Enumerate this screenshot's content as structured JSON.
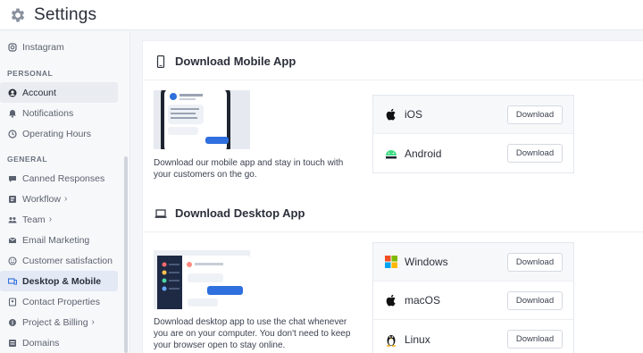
{
  "header": {
    "title": "Settings",
    "icon": "gear-icon"
  },
  "sidebar": {
    "top_item": {
      "label": "Instagram",
      "icon": "instagram-icon"
    },
    "sections": [
      {
        "title": "PERSONAL"
      },
      {
        "title": "GENERAL"
      }
    ],
    "personal_items": [
      {
        "label": "Account",
        "icon": "user-icon",
        "state": "active"
      },
      {
        "label": "Notifications",
        "icon": "bell-icon"
      },
      {
        "label": "Operating Hours",
        "icon": "clock-icon"
      }
    ],
    "general_items": [
      {
        "label": "Canned Responses",
        "icon": "chat-icon",
        "chevron": ""
      },
      {
        "label": "Workflow",
        "icon": "workflow-icon",
        "chevron": "›"
      },
      {
        "label": "Team",
        "icon": "team-icon",
        "chevron": "›"
      },
      {
        "label": "Email Marketing",
        "icon": "mail-icon",
        "chevron": ""
      },
      {
        "label": "Customer satisfaction",
        "icon": "smile-icon",
        "chevron": ""
      },
      {
        "label": "Desktop & Mobile",
        "icon": "devices-icon",
        "chevron": "",
        "state": "selected"
      },
      {
        "label": "Contact Properties",
        "icon": "contact-icon",
        "chevron": ""
      },
      {
        "label": "Project & Billing",
        "icon": "billing-icon",
        "chevron": "›"
      },
      {
        "label": "Domains",
        "icon": "domain-icon",
        "chevron": ""
      }
    ]
  },
  "mobile": {
    "heading": "Download Mobile App",
    "description": "Download our mobile app and stay in touch with your customers on the go.",
    "platforms": [
      {
        "name": "iOS",
        "icon": "apple-icon",
        "button": "Download"
      },
      {
        "name": "Android",
        "icon": "android-icon",
        "button": "Download"
      }
    ]
  },
  "desktop": {
    "heading": "Download Desktop App",
    "description": "Download desktop app to use the chat whenever you are on your computer. You don't need to keep your browser open to stay online.",
    "platforms": [
      {
        "name": "Windows",
        "icon": "windows-icon",
        "button": "Download"
      },
      {
        "name": "macOS",
        "icon": "apple-icon",
        "button": "Download"
      },
      {
        "name": "Linux",
        "icon": "linux-icon",
        "button": "Download"
      }
    ]
  },
  "colors": {
    "accent": "#2f6fde",
    "selected_bg": "#e3e9f5",
    "android_green": "#3ddc84"
  }
}
